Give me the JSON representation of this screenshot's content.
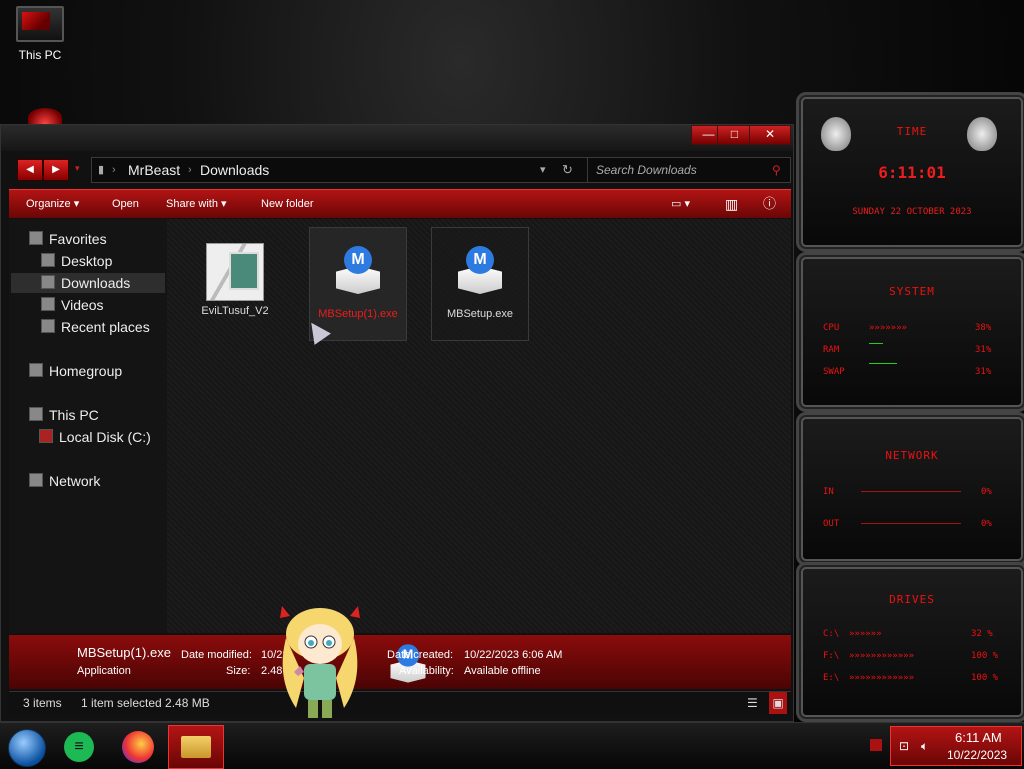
{
  "desktop": {
    "this_pc_label": "This PC"
  },
  "explorer": {
    "title_buttons": {
      "minimize": "—",
      "maximize": "□",
      "close": "✕"
    },
    "breadcrumb": [
      "MrBeast",
      "Downloads"
    ],
    "search_placeholder": "Search Downloads",
    "commands": {
      "organize": "Organize",
      "open": "Open",
      "share_with": "Share with",
      "new_folder": "New folder"
    },
    "nav": {
      "favorites": "Favorites",
      "desktop": "Desktop",
      "downloads": "Downloads",
      "videos": "Videos",
      "recent_places": "Recent places",
      "homegroup": "Homegroup",
      "this_pc": "This PC",
      "local_disk": "Local Disk (C:)",
      "network": "Network"
    },
    "files": [
      {
        "name": "EviLTusuf_V2"
      },
      {
        "name": "MBSetup(1).exe"
      },
      {
        "name": "MBSetup.exe"
      }
    ],
    "details": {
      "file_name": "MBSetup(1).exe",
      "file_type": "Application",
      "date_modified_label": "Date modified:",
      "date_modified_value": "10/22",
      "size_label": "Size:",
      "size_value": "2.48",
      "date_created_label": "Date created:",
      "date_created_value": "10/22/2023 6:06 AM",
      "availability_label": "Availability:",
      "availability_value": "Available offline"
    },
    "status": {
      "items": "3 items",
      "selected": "1 item selected  2.48 MB"
    }
  },
  "gadgets": {
    "time": {
      "title": "TIME",
      "clock": "6:11:01",
      "date": "SUNDAY 22 OCTOBER 2023"
    },
    "system": {
      "title": "SYSTEM",
      "rows": [
        {
          "label": "CPU",
          "value": "38%"
        },
        {
          "label": "RAM",
          "value": "31%"
        },
        {
          "label": "SWAP",
          "value": "31%"
        }
      ]
    },
    "network": {
      "title": "NETWORK",
      "rows": [
        {
          "label": "IN",
          "value": "0%"
        },
        {
          "label": "OUT",
          "value": "0%"
        }
      ]
    },
    "drives": {
      "title": "DRIVES",
      "rows": [
        {
          "label": "C:\\",
          "value": "32 %"
        },
        {
          "label": "F:\\",
          "value": "100 %"
        },
        {
          "label": "E:\\",
          "value": "100 %"
        }
      ]
    }
  },
  "taskbar": {
    "time": "6:11 AM",
    "date": "10/22/2023"
  },
  "colors": {
    "accent": "#b31414",
    "dark_bg": "#111111",
    "gadget_red": "#ee1c1c"
  }
}
